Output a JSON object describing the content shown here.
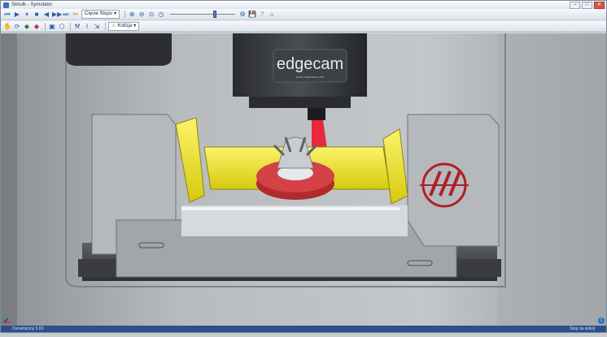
{
  "window": {
    "title": "Simulk - Symulator",
    "min": "–",
    "max": "□",
    "close": "✕"
  },
  "toolbar1": {
    "combo_label": "Cięcie Stopu",
    "icons": [
      "play-icon",
      "step-back-icon",
      "stop-icon",
      "rewind-icon",
      "fast-forward-icon",
      "end-icon",
      "cut-icon"
    ],
    "slider_level": 0.7
  },
  "toolbar2": {
    "combo_label": "Kolizja"
  },
  "viewport": {
    "spindle_brand": "edgecam",
    "spindle_sub": "www.edgecam.com",
    "colors": {
      "yellow": "#f2e71e",
      "red_tool": "#e8283a",
      "machine_gray": "#a6a9ac",
      "dark": "#3a3c40"
    }
  },
  "statusbar": {
    "left": "Dynamiczny 5.00",
    "right": "Stop na kolizji"
  },
  "info_glyph": "i"
}
